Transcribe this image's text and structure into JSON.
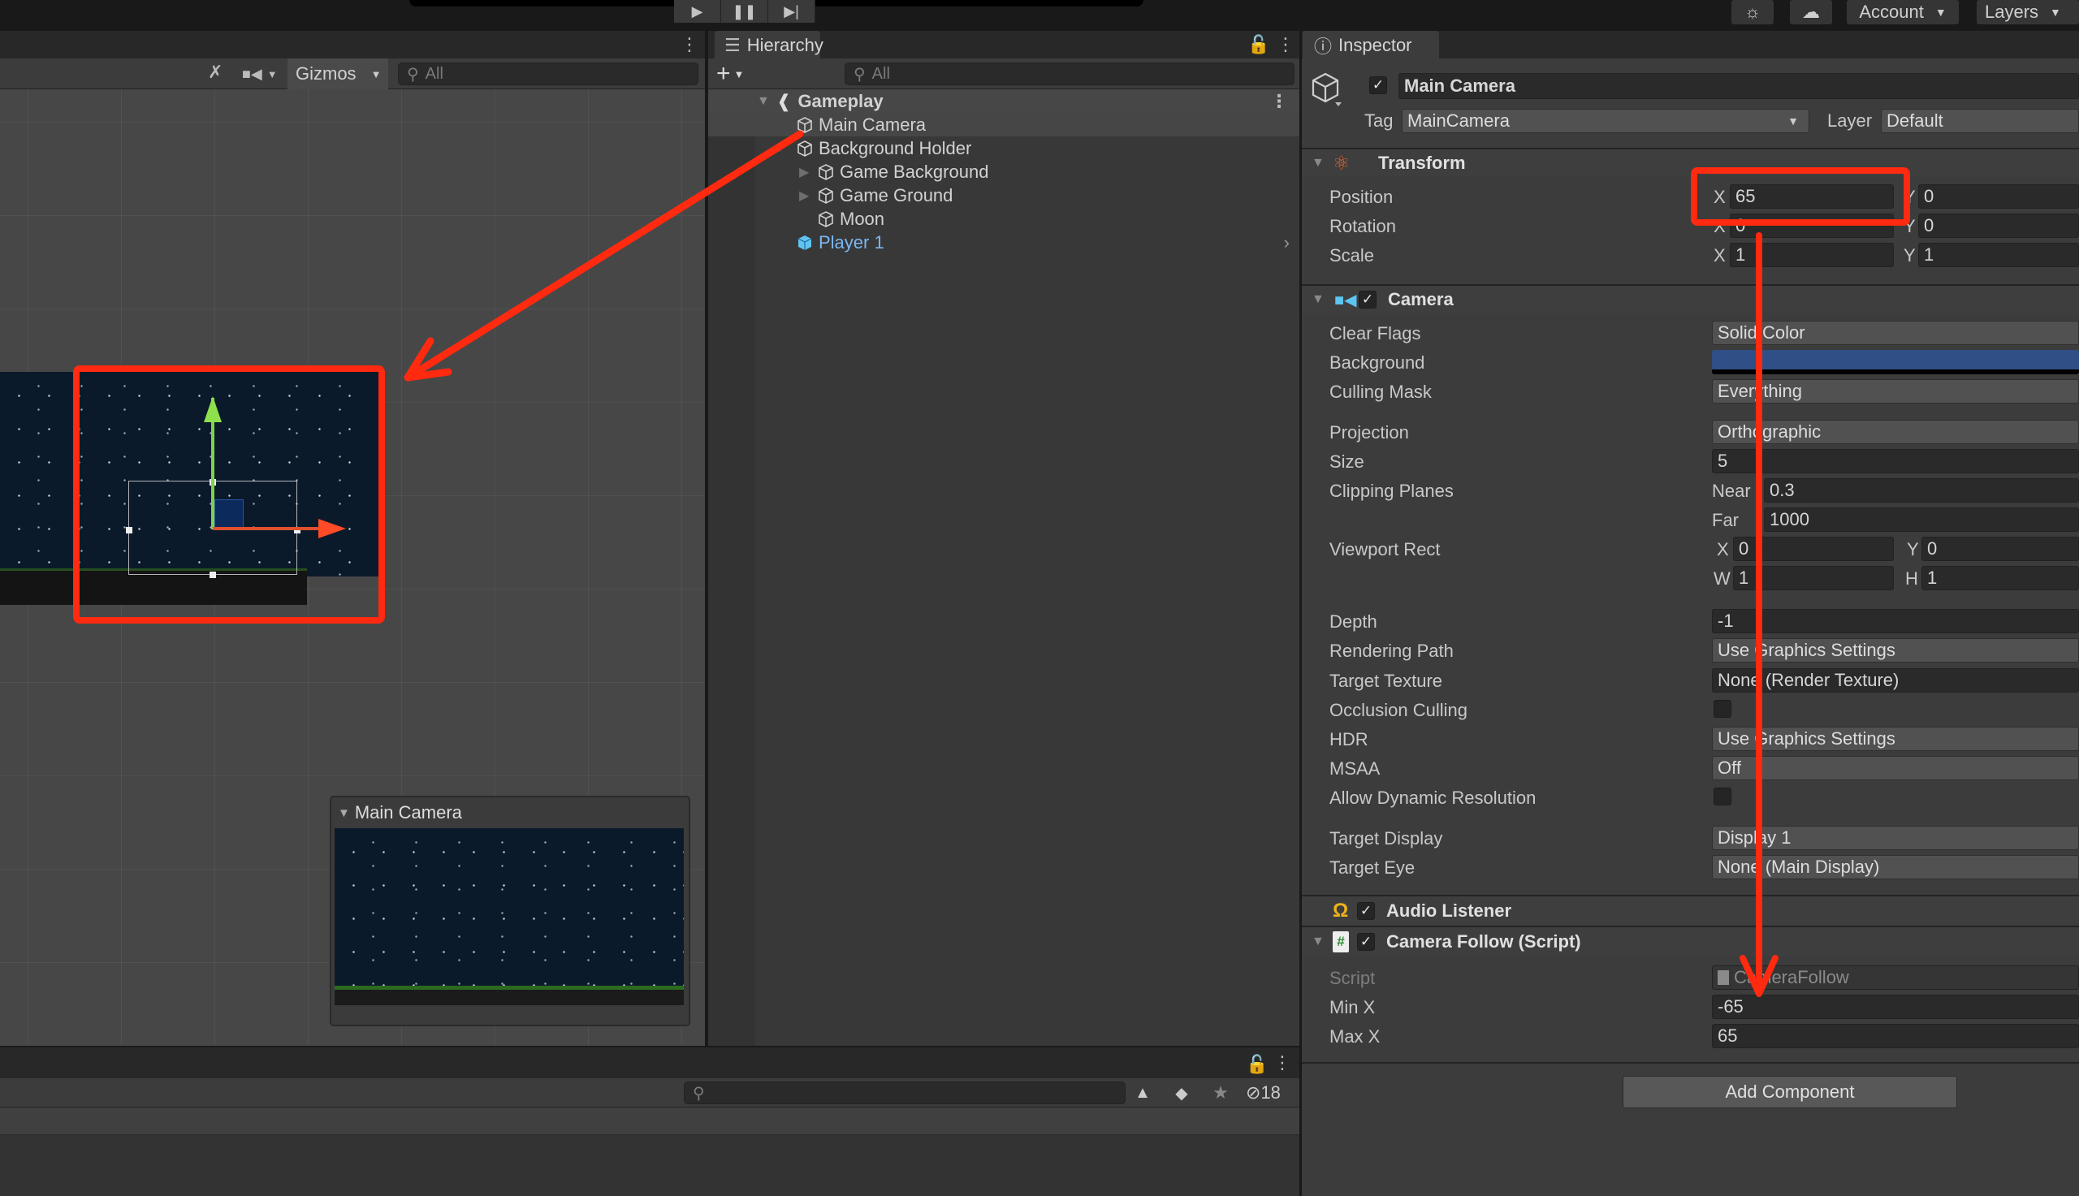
{
  "toolbar": {
    "play_controls": [
      "play",
      "pause",
      "step"
    ],
    "lighting_icon": "sun-icon",
    "cloud_icon": "cloud-icon",
    "account_label": "Account",
    "layers_label": "Layers"
  },
  "scene": {
    "gizmos_label": "Gizmos",
    "search_placeholder": "All",
    "camera_preview_title": "Main Camera"
  },
  "hierarchy": {
    "tab_label": "Hierarchy",
    "search_placeholder": "All",
    "scene_name": "Gameplay",
    "items": [
      {
        "label": "Main Camera",
        "depth": 1,
        "selected": true
      },
      {
        "label": "Background Holder",
        "depth": 1,
        "expanded": true
      },
      {
        "label": "Game Background",
        "depth": 2,
        "collapsed": true
      },
      {
        "label": "Game Ground",
        "depth": 2,
        "collapsed": true
      },
      {
        "label": "Moon",
        "depth": 2
      },
      {
        "label": "Player 1",
        "depth": 1,
        "prefab": true
      }
    ]
  },
  "project": {
    "search_placeholder": "",
    "hidden_count": "18"
  },
  "inspector": {
    "tab_label": "Inspector",
    "object_name": "Main Camera",
    "active": true,
    "tag_label": "Tag",
    "tag_value": "MainCamera",
    "layer_label": "Layer",
    "layer_value": "Default",
    "transform": {
      "title": "Transform",
      "position_label": "Position",
      "rotation_label": "Rotation",
      "scale_label": "Scale",
      "position": {
        "x": "65",
        "y": "0"
      },
      "rotation": {
        "x": "0",
        "y": "0"
      },
      "scale": {
        "x": "1",
        "y": "1"
      }
    },
    "camera": {
      "title": "Camera",
      "enabled": true,
      "rows": {
        "clear_flags": {
          "label": "Clear Flags",
          "value": "Solid Color"
        },
        "background": {
          "label": "Background",
          "color": "#2f4f86"
        },
        "culling_mask": {
          "label": "Culling Mask",
          "value": "Everything"
        },
        "projection": {
          "label": "Projection",
          "value": "Orthographic"
        },
        "size": {
          "label": "Size",
          "value": "5"
        },
        "clipping": {
          "label": "Clipping Planes",
          "near_label": "Near",
          "near": "0.3",
          "far_label": "Far",
          "far": "1000"
        },
        "viewport": {
          "label": "Viewport Rect",
          "x": "0",
          "y": "0",
          "w": "1",
          "h": "1"
        },
        "depth": {
          "label": "Depth",
          "value": "-1"
        },
        "rendering_path": {
          "label": "Rendering Path",
          "value": "Use Graphics Settings"
        },
        "target_texture": {
          "label": "Target Texture",
          "value": "None (Render Texture)"
        },
        "occlusion_culling": {
          "label": "Occlusion Culling",
          "checked": false
        },
        "hdr": {
          "label": "HDR",
          "value": "Use Graphics Settings"
        },
        "msaa": {
          "label": "MSAA",
          "value": "Off"
        },
        "dynamic_resolution": {
          "label": "Allow Dynamic Resolution",
          "checked": false
        },
        "target_display": {
          "label": "Target Display",
          "value": "Display 1"
        },
        "target_eye": {
          "label": "Target Eye",
          "value": "None (Main Display)"
        }
      }
    },
    "audio_listener": {
      "title": "Audio Listener",
      "enabled": true
    },
    "camera_follow": {
      "title": "Camera Follow (Script)",
      "enabled": true,
      "script_label": "Script",
      "script_value": "CameraFollow",
      "min_x_label": "Min X",
      "min_x": "-65",
      "max_x_label": "Max X",
      "max_x": "65"
    },
    "add_component_label": "Add Component"
  },
  "annotations": {
    "color": "#ff2a0f",
    "highlighted": [
      "scene camera gizmo",
      "Position X field"
    ]
  }
}
